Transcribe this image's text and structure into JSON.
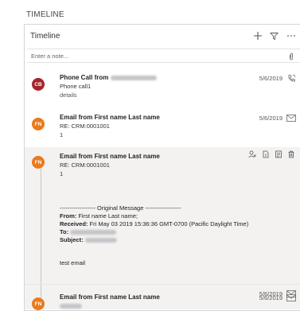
{
  "section_title": "TIMELINE",
  "card": {
    "title": "Timeline",
    "add_icon": "plus-icon",
    "filter_icon": "filter-icon",
    "more_icon": "ellipsis-icon"
  },
  "note": {
    "placeholder": "Enter a note..."
  },
  "entries": [
    {
      "avatar": "CB",
      "avatar_color": "#a4262c",
      "title": "Phone Call from",
      "sub1": "Phone call1",
      "sub2": "details",
      "date": "5/6/2019",
      "type_icon": "phone-icon"
    },
    {
      "avatar": "FN",
      "avatar_color": "#e97a1d",
      "title": "Email from First name Last name",
      "sub1": "RE: CRM:0001001",
      "sub2": "1",
      "date": "5/6/2019",
      "type_icon": "email-icon"
    },
    {
      "avatar": "FN",
      "avatar_color": "#e97a1d",
      "title": "Email from First name Last name",
      "sub1": "RE: CRM:0001001",
      "sub2": "1",
      "original_message": "------------------ Original Message ------------------",
      "from_label": "From:",
      "from_value": "First name Last name;",
      "received_label": "Received:",
      "received_value": "Fri May 03 2019 15:36:36 GMT-0700 (Pacific Daylight Time)",
      "to_label": "To:",
      "subject_label": "Subject:",
      "body": "test email",
      "footer_date": "5/6/2019"
    },
    {
      "avatar": "FN",
      "avatar_color": "#e97a1d",
      "title": "Email from First name Last name",
      "date": "5/6/2019",
      "type_icon": "email-icon"
    }
  ],
  "actions": [
    "assign-icon",
    "open-record-icon",
    "details-icon",
    "delete-icon"
  ]
}
